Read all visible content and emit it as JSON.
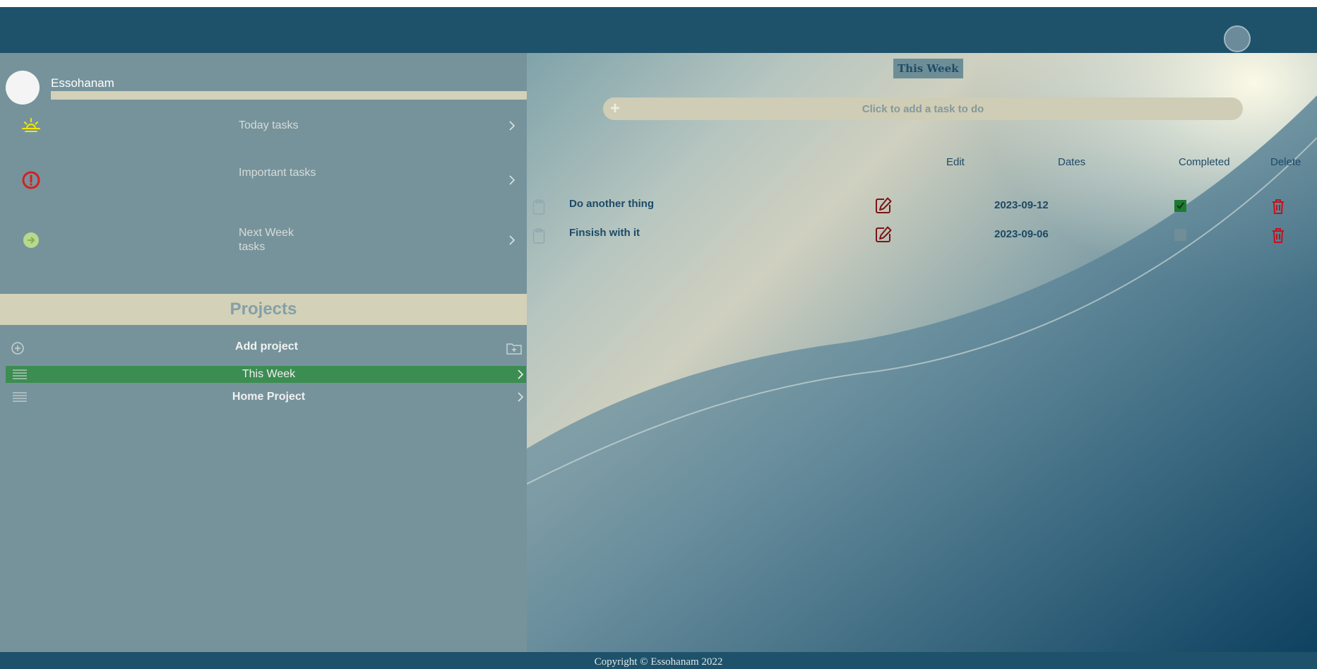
{
  "header": {
    "avatar_icon": "user-avatar-icon"
  },
  "sidebar": {
    "user": {
      "name": "Essohanam"
    },
    "nav": [
      {
        "label": "Today tasks",
        "icon": "sunrise-icon",
        "icon_color": "#f2e600"
      },
      {
        "label": "Important tasks",
        "icon": "exclamation-circle-icon",
        "icon_color": "#d42020"
      },
      {
        "label": "Next Week tasks",
        "icon": "arrow-circle-icon",
        "icon_color": "#b7d98a"
      }
    ],
    "projects_title": "Projects",
    "add_project_label": "Add project",
    "projects": [
      {
        "label": "This Week",
        "active": true
      },
      {
        "label": "Home Project",
        "active": false
      }
    ]
  },
  "main": {
    "view_title": "This Week",
    "add_task_placeholder": "Click to add a task to do",
    "columns": {
      "edit": "Edit",
      "dates": "Dates",
      "completed": "Completed",
      "delete": "Delete"
    },
    "tasks": [
      {
        "name": "Do another thing",
        "date": "2023-09-12",
        "completed": true
      },
      {
        "name": "Finsish with it",
        "date": "2023-09-06",
        "completed": false
      }
    ]
  },
  "footer": {
    "copyright": "Copyright © Essohanam 2022"
  },
  "colors": {
    "topbar": "#1e526b",
    "sidebar": "#76939c",
    "accent_beige": "#d3d1b8",
    "active_project": "#3c8d52",
    "edit_icon": "#7a1515",
    "delete_icon": "#c0131d",
    "completed_check": "#1e7a32"
  }
}
